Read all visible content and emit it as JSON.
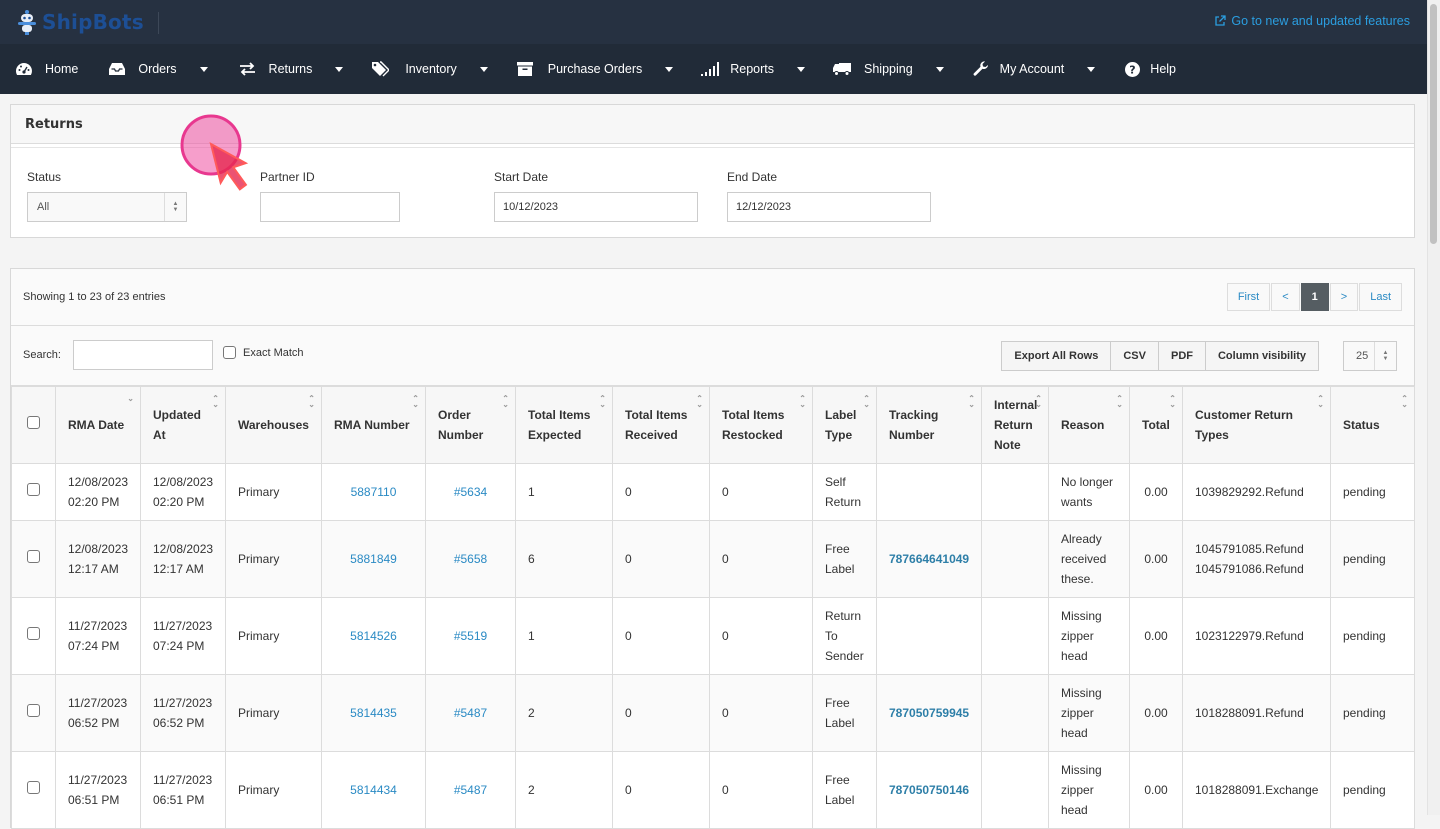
{
  "topbar": {
    "logo_text": "ShipBots",
    "new_features_link": "Go to new and updated features",
    "new_features_icon": "external-link-icon"
  },
  "nav": [
    {
      "label": "Home",
      "icon": "dashboard-icon",
      "dropdown": false
    },
    {
      "label": "Orders",
      "icon": "inbox-icon",
      "dropdown": true
    },
    {
      "label": "Returns",
      "icon": "exchange-icon",
      "dropdown": true
    },
    {
      "label": "Inventory",
      "icon": "tags-icon",
      "dropdown": true
    },
    {
      "label": "Purchase Orders",
      "icon": "archive-box-icon",
      "dropdown": true
    },
    {
      "label": "Reports",
      "icon": "signal-bars-icon",
      "dropdown": true
    },
    {
      "label": "Shipping",
      "icon": "truck-icon",
      "dropdown": true
    },
    {
      "label": "My Account",
      "icon": "wrench-icon",
      "dropdown": true
    },
    {
      "label": "Help",
      "icon": "question-circle-icon",
      "dropdown": false
    }
  ],
  "filters": {
    "title": "Returns",
    "status_label": "Status",
    "status_value": "All",
    "partner_label": "Partner ID",
    "partner_value": "",
    "start_label": "Start Date",
    "start_value": "10/12/2023",
    "end_label": "End Date",
    "end_value": "12/12/2023"
  },
  "table_controls": {
    "info": "Showing 1 to 23 of 23 entries",
    "pager": {
      "first": "First",
      "prev": "<",
      "current": "1",
      "next": ">",
      "last": "Last"
    },
    "search_label": "Search:",
    "search_value": "",
    "exact_match_label": "Exact Match",
    "buttons": {
      "export_all": "Export All Rows",
      "csv": "CSV",
      "pdf": "PDF",
      "column_visibility": "Column visibility"
    },
    "page_length": "25"
  },
  "table": {
    "headers": [
      "RMA Date",
      "Updated At",
      "Warehouses",
      "RMA Number",
      "Order Number",
      "Total Items Expected",
      "Total Items Received",
      "Total Items Restocked",
      "Label Type",
      "Tracking Number",
      "Internal Return Note",
      "Reason",
      "Total",
      "Customer Return Types",
      "Status"
    ],
    "rows": [
      {
        "rma_date": "12/08/2023 02:20 PM",
        "updated_at": "12/08/2023 02:20 PM",
        "warehouse": "Primary",
        "rma_number": "5887110",
        "order_number": "#5634",
        "expected": "1",
        "received": "0",
        "restocked": "0",
        "label_type": "Self Return",
        "tracking": "",
        "note": "",
        "reason": "No longer wants",
        "total": "0.00",
        "return_types": "1039829292.Refund",
        "status": "pending"
      },
      {
        "rma_date": "12/08/2023 12:17 AM",
        "updated_at": "12/08/2023 12:17 AM",
        "warehouse": "Primary",
        "rma_number": "5881849",
        "order_number": "#5658",
        "expected": "6",
        "received": "0",
        "restocked": "0",
        "label_type": "Free Label",
        "tracking": "787664641049",
        "note": "",
        "reason": "Already received these.",
        "total": "0.00",
        "return_types": "1045791085.Refund 1045791086.Refund",
        "status": "pending"
      },
      {
        "rma_date": "11/27/2023 07:24 PM",
        "updated_at": "11/27/2023 07:24 PM",
        "warehouse": "Primary",
        "rma_number": "5814526",
        "order_number": "#5519",
        "expected": "1",
        "received": "0",
        "restocked": "0",
        "label_type": "Return To Sender",
        "tracking": "",
        "note": "",
        "reason": "Missing zipper head",
        "total": "0.00",
        "return_types": "1023122979.Refund",
        "status": "pending"
      },
      {
        "rma_date": "11/27/2023 06:52 PM",
        "updated_at": "11/27/2023 06:52 PM",
        "warehouse": "Primary",
        "rma_number": "5814435",
        "order_number": "#5487",
        "expected": "2",
        "received": "0",
        "restocked": "0",
        "label_type": "Free Label",
        "tracking": "787050759945",
        "note": "",
        "reason": "Missing zipper head",
        "total": "0.00",
        "return_types": "1018288091.Refund",
        "status": "pending"
      },
      {
        "rma_date": "11/27/2023 06:51 PM",
        "updated_at": "11/27/2023 06:51 PM",
        "warehouse": "Primary",
        "rma_number": "5814434",
        "order_number": "#5487",
        "expected": "2",
        "received": "0",
        "restocked": "0",
        "label_type": "Free Label",
        "tracking": "787050750146",
        "note": "",
        "reason": "Missing zipper head",
        "total": "0.00",
        "return_types": "1018288091.Exchange",
        "status": "pending"
      }
    ]
  },
  "colors": {
    "topbar_bg": "#263141",
    "navbar_bg": "#212b38",
    "link": "#2a8ac4",
    "active_page": "#555d62",
    "cursor_highlight": "#ee4fa0"
  }
}
